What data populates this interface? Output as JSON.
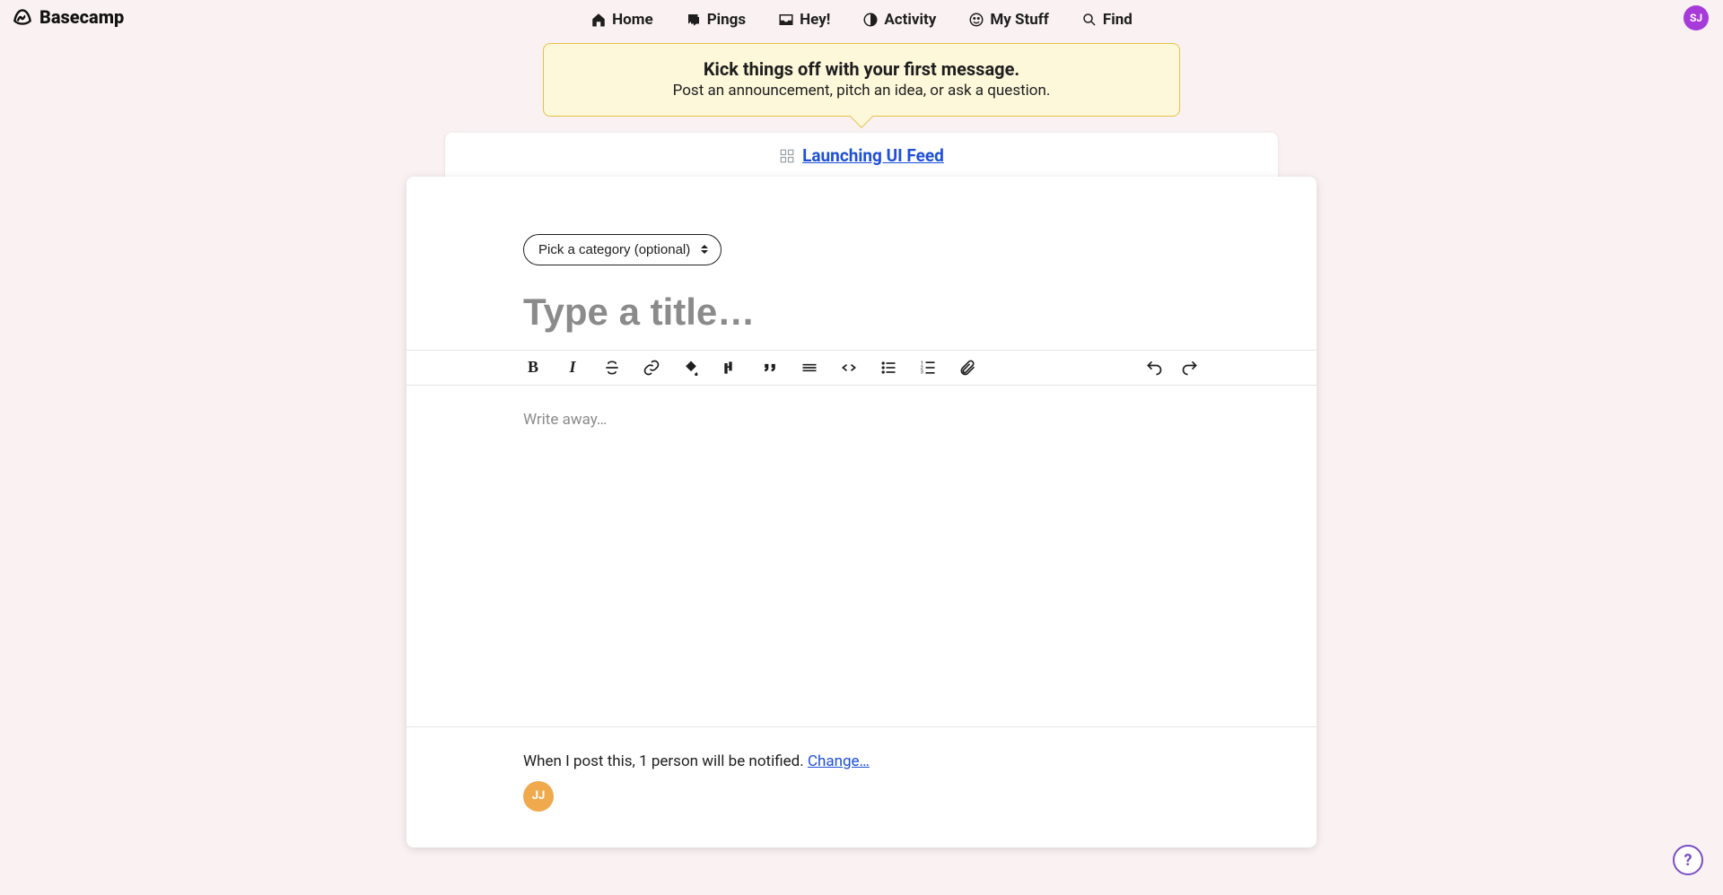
{
  "brand": "Basecamp",
  "nav": {
    "home": "Home",
    "pings": "Pings",
    "hey": "Hey!",
    "activity": "Activity",
    "mystuff": "My Stuff",
    "find": "Find"
  },
  "avatar_initials": "SJ",
  "hint": {
    "title": "Kick things off with your first message.",
    "subtitle": "Post an announcement, pitch an idea, or ask a question."
  },
  "breadcrumb": {
    "label": "Launching UI Feed"
  },
  "composer": {
    "category_label": "Pick a category (optional)",
    "title_placeholder": "Type a title…",
    "body_placeholder": "Write away…"
  },
  "notify": {
    "text_prefix": "When I post this, 1 person will be notified. ",
    "change": "Change…",
    "person_initials": "JJ"
  },
  "help": "?"
}
